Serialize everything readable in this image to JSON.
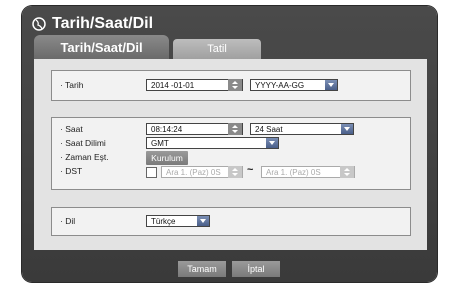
{
  "window": {
    "title": "Tarih/Saat/Dil"
  },
  "tabs": [
    {
      "label": "Tarih/Saat/Dil"
    },
    {
      "label": "Tatil"
    }
  ],
  "date_group": {
    "label": "· Tarih",
    "date_value": "2014 -01-01",
    "format_value": "YYYY-AA-GG"
  },
  "time_group": {
    "time_label": "· Saat",
    "time_value": "08:14:24",
    "hour_format": "24 Saat",
    "timezone_label": "· Saat Dilimi",
    "timezone_value": "GMT",
    "sync_label": "· Zaman Eşt.",
    "sync_button": "Kurulum",
    "dst_label": "· DST",
    "dst_start": "Ara 1. (Paz) 0S",
    "dst_separator": "~",
    "dst_end": "Ara 1. (Paz) 0S"
  },
  "language_group": {
    "label": "· Dil",
    "value": "Türkçe"
  },
  "footer": {
    "ok_label": "Tamam",
    "cancel_label": "İptal"
  }
}
